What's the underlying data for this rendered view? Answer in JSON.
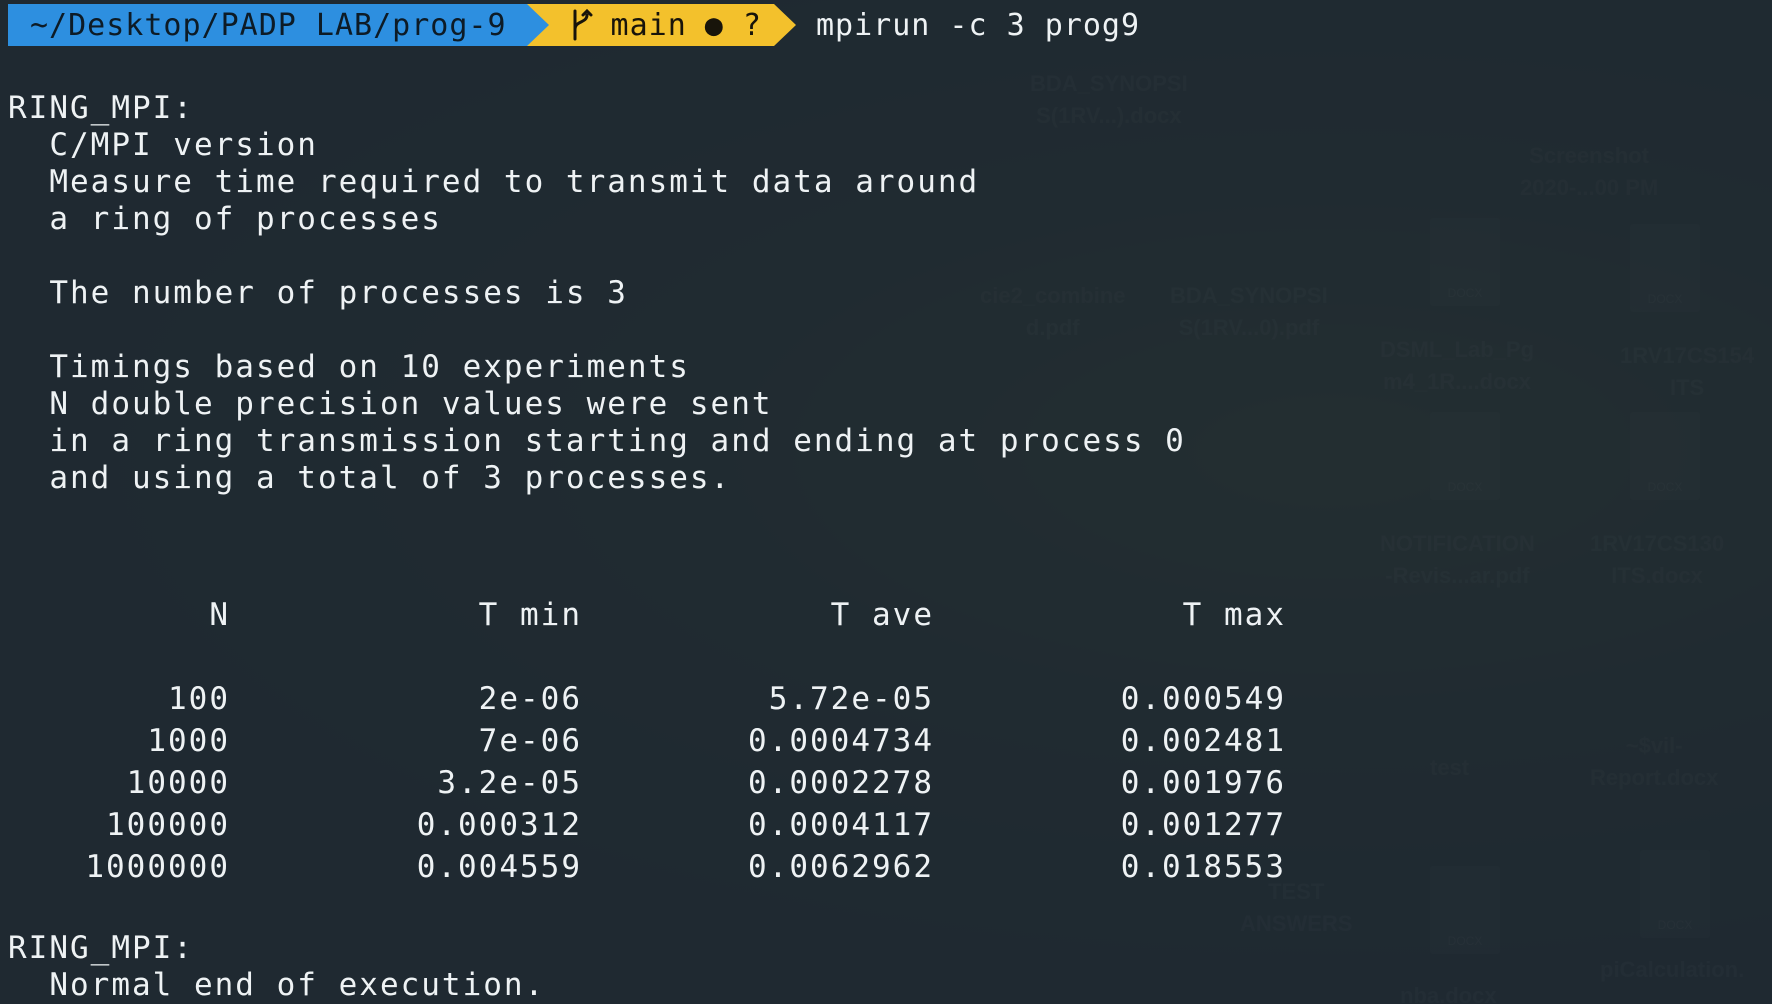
{
  "prompt": {
    "path": "~/Desktop/PADP LAB/prog-9",
    "branch": "main",
    "git_status": "● ?",
    "command": "mpirun -c 3 prog9"
  },
  "output_lines": [
    "RING_MPI:",
    "  C/MPI version",
    "  Measure time required to transmit data around",
    "  a ring of processes",
    "",
    "  The number of processes is 3",
    "",
    "  Timings based on 10 experiments",
    "  N double precision values were sent",
    "  in a ring transmission starting and ending at process 0",
    "  and using a total of 3 processes."
  ],
  "table": {
    "headers": [
      "N",
      "T min",
      "T ave",
      "T max"
    ],
    "rows": [
      [
        "100",
        "2e-06",
        "5.72e-05",
        "0.000549"
      ],
      [
        "1000",
        "7e-06",
        "0.0004734",
        "0.002481"
      ],
      [
        "10000",
        "3.2e-05",
        "0.0002278",
        "0.001976"
      ],
      [
        "100000",
        "0.000312",
        "0.0004117",
        "0.001277"
      ],
      [
        "1000000",
        "0.004559",
        "0.0062962",
        "0.018553"
      ]
    ]
  },
  "footer_lines": [
    "RING_MPI:",
    "  Normal end of execution."
  ],
  "colors": {
    "path_segment": "#2d8fe0",
    "git_segment": "#f3c12c",
    "terminal_bg": "#23303a",
    "text": "#eef2f4"
  },
  "icons": {
    "branch": "git-branch-icon"
  }
}
